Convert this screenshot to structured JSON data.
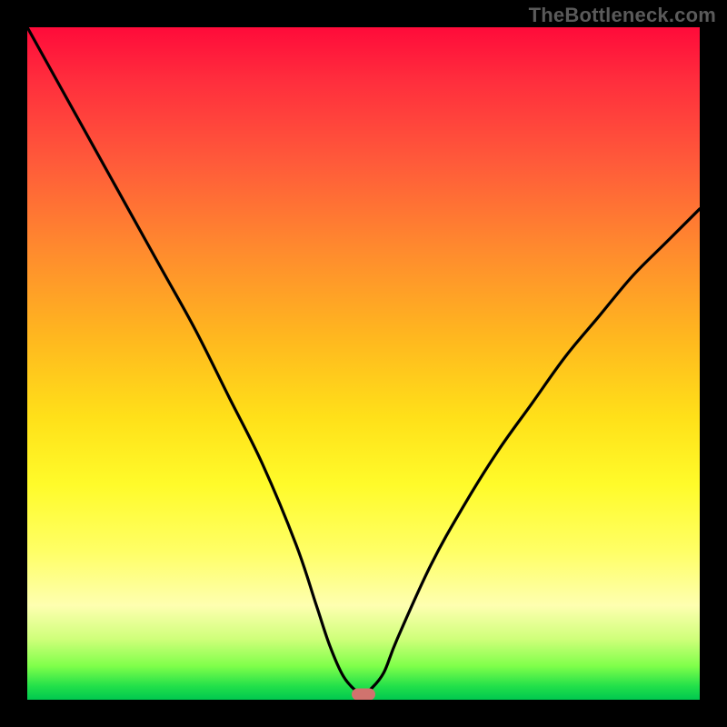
{
  "watermark": {
    "text": "TheBottleneck.com"
  },
  "colors": {
    "background": "#000000",
    "curve": "#000000",
    "marker": "#d0736e",
    "gradient_top": "#ff0b3a",
    "gradient_bottom": "#00c84f"
  },
  "chart_data": {
    "type": "line",
    "title": "",
    "xlabel": "",
    "ylabel": "",
    "xlim": [
      0,
      100
    ],
    "ylim": [
      0,
      100
    ],
    "grid": false,
    "legend": false,
    "series": [
      {
        "name": "bottleneck-curve",
        "x": [
          0,
          5,
          10,
          15,
          20,
          25,
          30,
          35,
          40,
          43,
          45,
          47,
          49,
          50,
          51,
          53,
          55,
          60,
          65,
          70,
          75,
          80,
          85,
          90,
          95,
          100
        ],
        "values": [
          100,
          91,
          82,
          73,
          64,
          55,
          45,
          35,
          23,
          14,
          8,
          3.5,
          1.2,
          0.8,
          1.5,
          4,
          9,
          20,
          29,
          37,
          44,
          51,
          57,
          63,
          68,
          73
        ]
      }
    ],
    "annotations": [
      {
        "name": "optimal-marker",
        "x": 50,
        "y": 0.8
      }
    ]
  }
}
